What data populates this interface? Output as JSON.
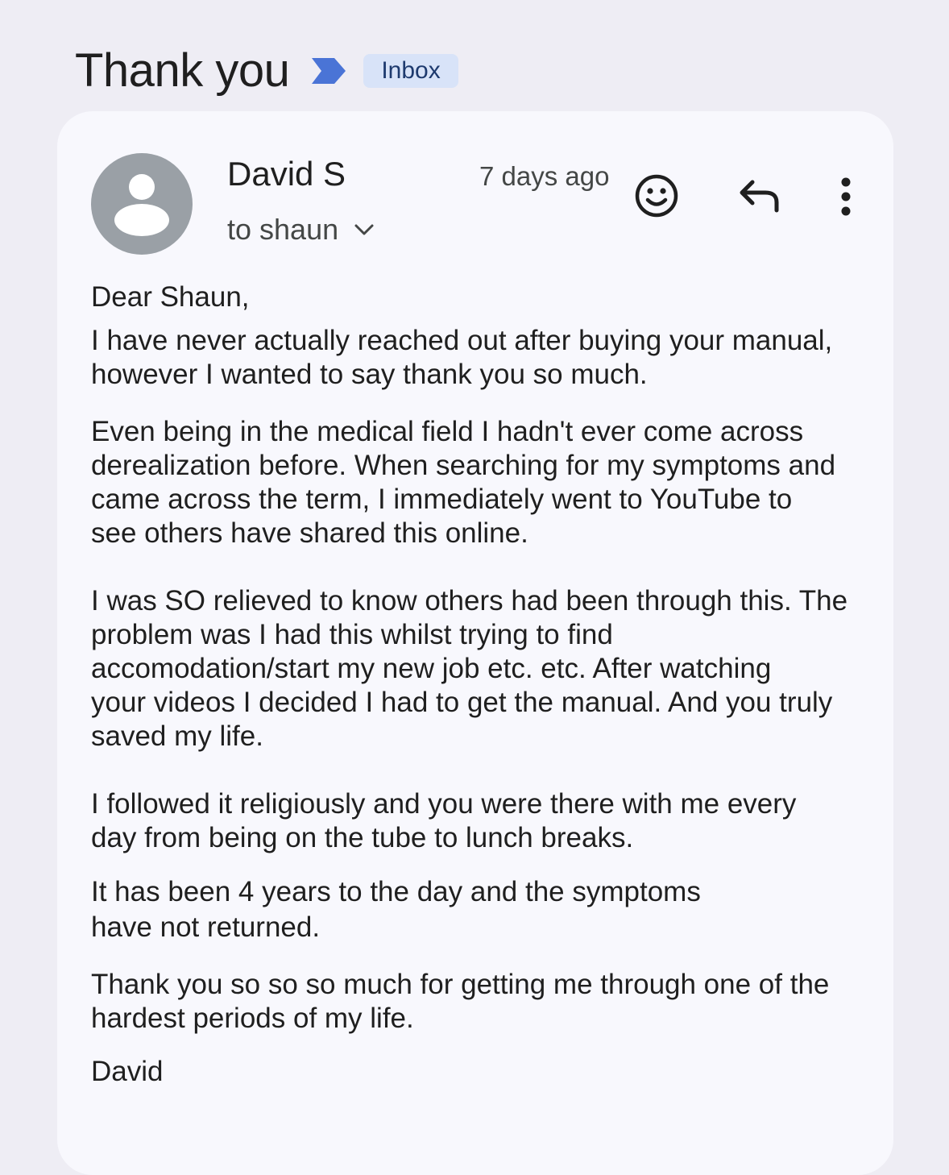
{
  "header": {
    "subject": "Thank you",
    "label": "Inbox",
    "importance_color": "#4a74d6"
  },
  "message": {
    "sender": "David S",
    "recipients": "to shaun",
    "time": "7 days ago",
    "icons": {
      "avatar": "person-avatar-icon",
      "recipients_toggle": "chevron-down-icon",
      "react": "emoji-icon",
      "reply": "reply-icon",
      "more": "more-vert-icon"
    },
    "body": {
      "greeting": "Dear Shaun,",
      "p1": [
        "I have never actually reached out after buying your manual,",
        "however I wanted to say thank you so much."
      ],
      "p2": [
        "Even being in the medical field I hadn't ever come across",
        "derealization before. When searching for my symptoms and",
        "came across the term, I immediately went to YouTube to",
        "see others have shared this online."
      ],
      "p3": [
        "I was SO relieved to know others had been through this. The",
        "problem was I had this whilst trying to find",
        "accomodation/start my new job etc. etc. After watching",
        "your videos I decided I had to get the manual. And you truly",
        "saved my life."
      ],
      "p4": [
        "I followed it religiously and you were there with me every",
        "day from being on the tube to lunch breaks."
      ],
      "p5": [
        "It has been 4 years to the day and the symptoms",
        "have not returned."
      ],
      "p6": [
        "Thank you so so so much for getting me through one of the",
        "hardest periods of my life."
      ],
      "signature": "David"
    }
  }
}
